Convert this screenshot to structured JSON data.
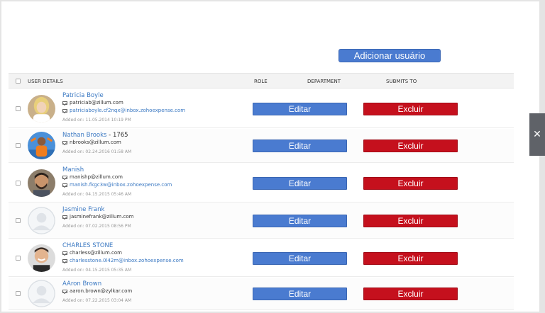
{
  "actions": {
    "add_user_label": "Adicionar usuário"
  },
  "table": {
    "headers": {
      "user_details": "USER DETAILS",
      "role": "ROLE",
      "department": "DEPARTMENT",
      "submits_to": "SUBMITS TO"
    },
    "edit_label": "Editar",
    "delete_label": "Excluir",
    "rows": [
      {
        "name": "Patricia Boyle",
        "extra": "",
        "email": "patriciab@zillum.com",
        "inbox": "patriciaboyle.cf2nqx@inbox.zohoexpense.com",
        "added": "Added on: 11.05.2014 10:19 PM",
        "avatar": "photo-blonde"
      },
      {
        "name": "Nathan Brooks",
        "extra": " - 1765",
        "email": "nbrooks@zillum.com",
        "inbox": "",
        "added": "Added on: 02.24.2016 01:58 AM",
        "avatar": "photo-orange"
      },
      {
        "name": "Manish",
        "extra": "",
        "email": "manishp@zillum.com",
        "inbox": "manish.fkgc3w@inbox.zohoexpense.com",
        "added": "Added on: 04.15.2015 05:46 AM",
        "avatar": "photo-beard"
      },
      {
        "name": "Jasmine Frank",
        "extra": "",
        "email": "jasminefrank@zillum.com",
        "inbox": "",
        "added": "Added on: 07.02.2015 08:56 PM",
        "avatar": "placeholder"
      },
      {
        "name": "CHARLES STONE",
        "extra": "",
        "email": "charless@zillum.com",
        "inbox": "charlesstone.0l42m@inbox.zohoexpense.com",
        "added": "Added on: 04.15.2015 05:35 AM",
        "avatar": "photo-smile"
      },
      {
        "name": "AAron Brown",
        "extra": "",
        "email": "aaron.brown@zylkar.com",
        "inbox": "",
        "added": "Added on: 07.22.2015 03:04 AM",
        "avatar": "placeholder"
      }
    ]
  },
  "close_tab": {
    "icon": "close-icon",
    "glyph": "✕"
  },
  "colors": {
    "primary": "#4a7bd0",
    "danger": "#c5101d",
    "link": "#3a78c2"
  }
}
